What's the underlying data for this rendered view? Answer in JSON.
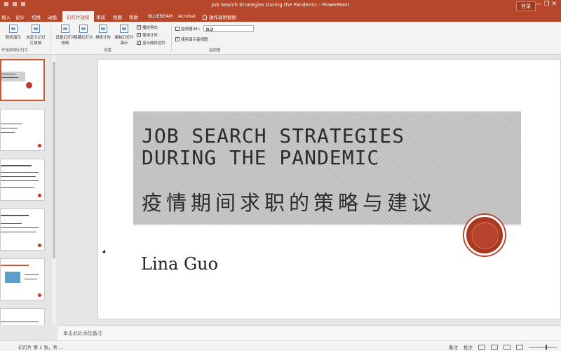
{
  "window": {
    "title": "Job Search Strategies During the Pandemic  -  PowerPoint",
    "signin_label": "登录",
    "controls": "—  ❐  ✕"
  },
  "tabs": [
    {
      "label": "插入"
    },
    {
      "label": "设计"
    },
    {
      "label": "切换"
    },
    {
      "label": "动画"
    },
    {
      "label": "幻灯片放映"
    },
    {
      "label": "审阅"
    },
    {
      "label": "视图"
    },
    {
      "label": "帮助"
    },
    {
      "label": "BLUEBEAM"
    },
    {
      "label": "Acrobat"
    },
    {
      "label": "操作说明搜索"
    }
  ],
  "ribbon": {
    "buttons": [
      {
        "label": "联机演示"
      },
      {
        "label": "自定义幻灯片放映"
      },
      {
        "label": "设置幻灯片放映"
      },
      {
        "label": "隐藏幻灯片"
      },
      {
        "label": "排练计时"
      },
      {
        "label": "录制幻灯片演示"
      }
    ],
    "checks": [
      {
        "label": "播放旁白",
        "checked": true
      },
      {
        "label": "使用计时",
        "checked": true
      },
      {
        "label": "显示媒体控件",
        "checked": true
      }
    ],
    "groups": {
      "start": "开始放映幻灯片",
      "setup": "设置",
      "monitors": "监视器"
    },
    "monitor_label": "监视器(M):",
    "monitor_value": "自动",
    "presenter_view": "使用演示者视图"
  },
  "slide": {
    "title_line1": "JOB SEARCH STRATEGIES",
    "title_line2": "DURING THE PANDEMIC",
    "subtitle_cn": "疫情期间求职的策略与建议",
    "author": "Lina Guo"
  },
  "notes": {
    "placeholder": "单击此处添加备注"
  },
  "status": {
    "notes_button": "备注",
    "comments_button": "批注",
    "slide_info": "幻灯片 第 1 张，共 …"
  },
  "colors": {
    "accent": "#b7472a",
    "seal": "#b8432c"
  }
}
